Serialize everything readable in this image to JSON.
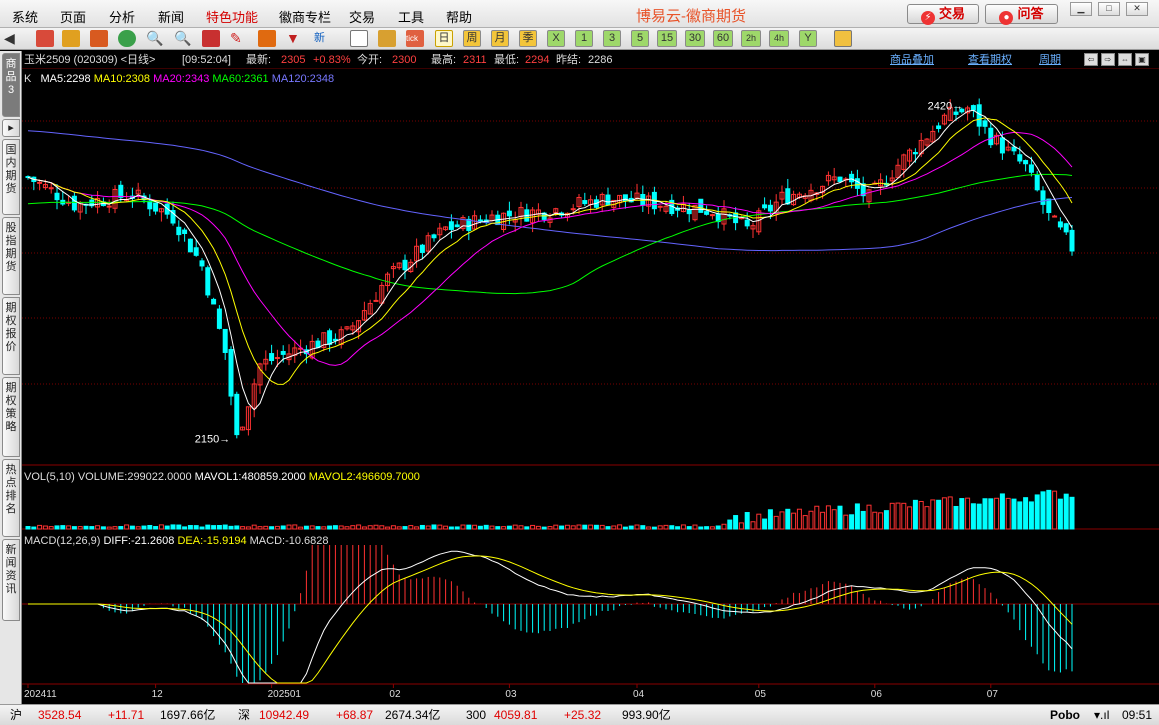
{
  "menubar": {
    "items": [
      "系统",
      "页面",
      "分析",
      "新闻",
      "特色功能",
      "徽商专栏",
      "交易",
      "工具",
      "帮助"
    ],
    "special_index": 4,
    "title": "博易云-徽商期货",
    "trade_button": "交易",
    "qa_button": "问答"
  },
  "toolbar": {
    "periods": [
      "日",
      "周",
      "月",
      "季",
      "X",
      "1",
      "3",
      "5",
      "15",
      "30",
      "60",
      "2h",
      "4h",
      "Y"
    ],
    "active_period": "日"
  },
  "sidebar": {
    "tabs": [
      "商品3",
      "国内期货",
      "股指期货",
      "期权报价",
      "期权策略",
      "热点排名",
      "新闻资讯"
    ]
  },
  "quote": {
    "name": "玉米2509 (020309) <日线>",
    "time": "[09:52:04]",
    "latest_label": "最新:",
    "latest": "2305",
    "change": "+0.83%",
    "open_label": "今开:",
    "open": "2300",
    "high_label": "最高:",
    "high": "2311",
    "low_label": "最低:",
    "low": "2294",
    "prev_label": "昨结:",
    "prev": "2286",
    "links": [
      "商品叠加",
      "查看期权",
      "周期"
    ]
  },
  "ma_legend": {
    "k": "K",
    "ma5": "MA5:2298",
    "ma10": "MA10:2308",
    "ma20": "MA20:2343",
    "ma60": "MA60:2361",
    "ma120": "MA120:2348"
  },
  "colors": {
    "up": "#ff3232",
    "down": "#00ffff",
    "ma5": "#ffffff",
    "ma10": "#ffff00",
    "ma20": "#ff00ff",
    "ma60": "#00ff00",
    "ma120": "#6464ff",
    "grid": "#7a0000"
  },
  "vol_legend": {
    "title": "VOL(5,10)",
    "volume": "VOLUME:299022.0000",
    "mavol1": "MAVOL1:480859.2000",
    "mavol2": "MAVOL2:496609.7000"
  },
  "macd_legend": {
    "title": "MACD(12,26,9)",
    "diff": "DIFF:-21.2608",
    "dea": "DEA:-15.9194",
    "macd": "MACD:-10.6828"
  },
  "annotations": {
    "high_label": "2420",
    "low_label": "2150"
  },
  "xaxis": [
    "202411",
    "12",
    "202501",
    "02",
    "03",
    "04",
    "05",
    "06",
    "07"
  ],
  "statusbar": {
    "sh_label": "沪",
    "sh_index": "3528.54",
    "sh_change": "+11.71",
    "sh_amount": "1697.66亿",
    "sz_label": "深",
    "sz_index": "10942.49",
    "sz_change": "+68.87",
    "sz_amount": "2674.34亿",
    "c300_label": "300",
    "c300_index": "4059.81",
    "c300_change": "+25.32",
    "c300_amount": "993.90亿",
    "brand": "Pobo",
    "clock": "09:51"
  },
  "chart_data": {
    "type": "candlestick",
    "symbol": "玉米2509",
    "xaxis_ticks": [
      "202411",
      "12",
      "202501",
      "02",
      "03",
      "04",
      "05",
      "06",
      "07"
    ],
    "extremes": {
      "high": 2420,
      "low": 2150
    },
    "last": {
      "open": 2300,
      "high": 2311,
      "low": 2294,
      "close": 2305,
      "prev_settle": 2286
    },
    "indicators": {
      "MA5": 2298,
      "MA10": 2308,
      "MA20": 2343,
      "MA60": 2361,
      "MA120": 2348
    },
    "volume": {
      "VOLUME": 299022,
      "MAVOL1": 480859.2,
      "MAVOL2": 496609.7
    },
    "macd": {
      "DIFF": -21.2608,
      "DEA": -15.9194,
      "MACD": -10.6828
    }
  }
}
